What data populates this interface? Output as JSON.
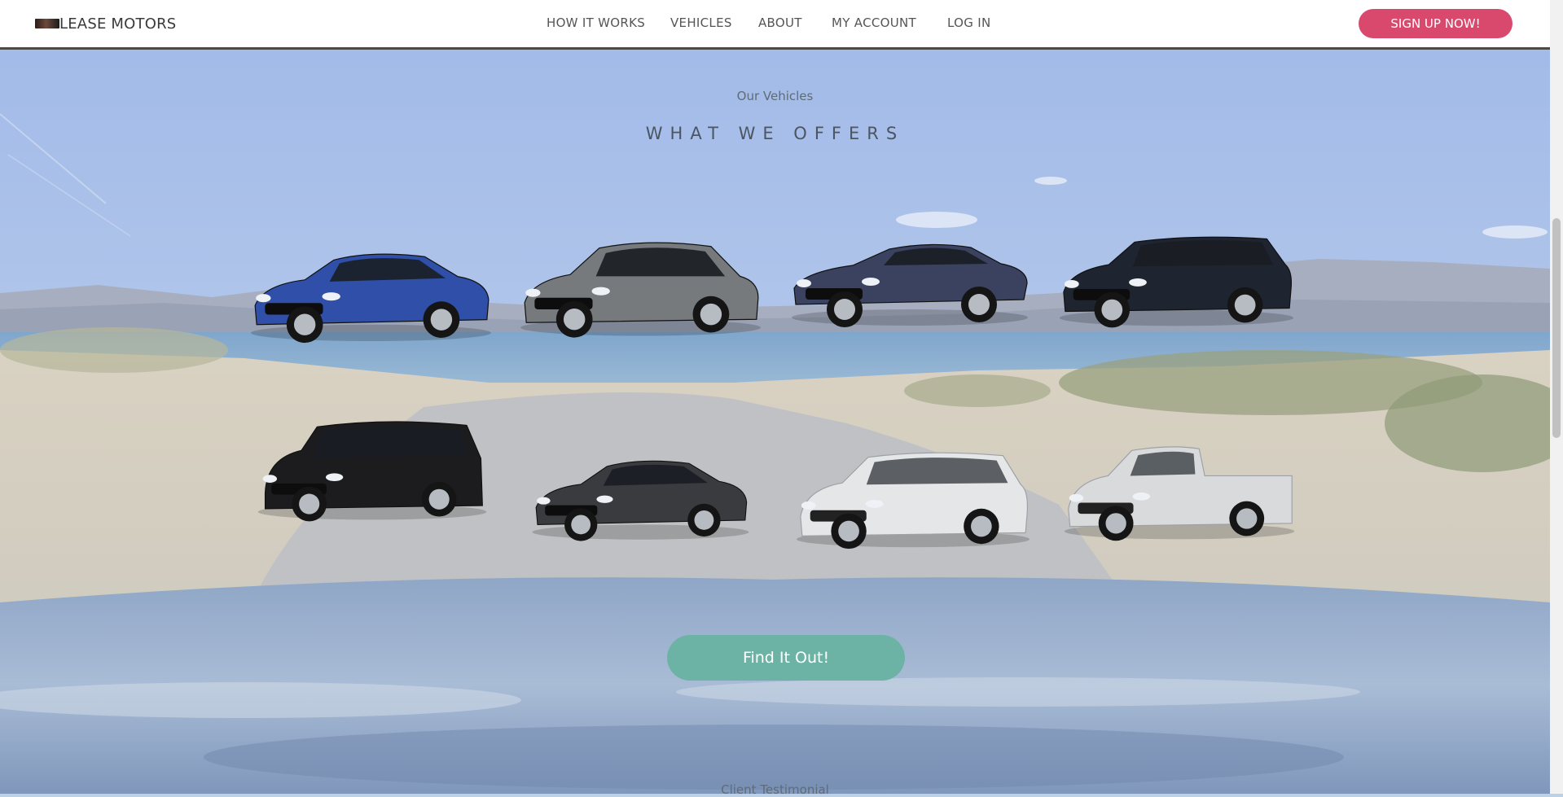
{
  "header": {
    "logo_text": "LEASE MOTORS",
    "nav": [
      {
        "label": "HOW IT WORKS",
        "name": "nav-how-it-works"
      },
      {
        "label": "VEHICLES",
        "name": "nav-vehicles"
      },
      {
        "label": "ABOUT",
        "name": "nav-about"
      },
      {
        "label": "MY ACCOUNT",
        "name": "nav-my-account"
      },
      {
        "label": "LOG IN",
        "name": "nav-log-in"
      }
    ],
    "signup_label": "SIGN UP NOW!"
  },
  "section": {
    "subtitle": "Our Vehicles",
    "title": "WHAT WE OFFERS",
    "cta_label": "Find It Out!",
    "next_section_label": "Client Testimonial"
  },
  "vehicles": [
    {
      "name": "bmw-sedan",
      "color": "#2f4fa8",
      "style": "sedan"
    },
    {
      "name": "vw-hatchback",
      "color": "#767a7d",
      "style": "hatch"
    },
    {
      "name": "aston-coupe",
      "color": "#3b4260",
      "style": "coupe"
    },
    {
      "name": "audi-wagon",
      "color": "#1e2430",
      "style": "wagon"
    },
    {
      "name": "mercedes-van",
      "color": "#1c1c1e",
      "style": "van"
    },
    {
      "name": "toyota-sedan",
      "color": "#3a3b3e",
      "style": "sedan"
    },
    {
      "name": "hyundai-suv",
      "color": "#e4e6e8",
      "style": "suv"
    },
    {
      "name": "toyota-pickup",
      "color": "#d8dadc",
      "style": "pickup"
    }
  ],
  "colors": {
    "accent": "#d9496e",
    "cta": "#6cb3a5",
    "header_border": "#4a4a4a"
  }
}
